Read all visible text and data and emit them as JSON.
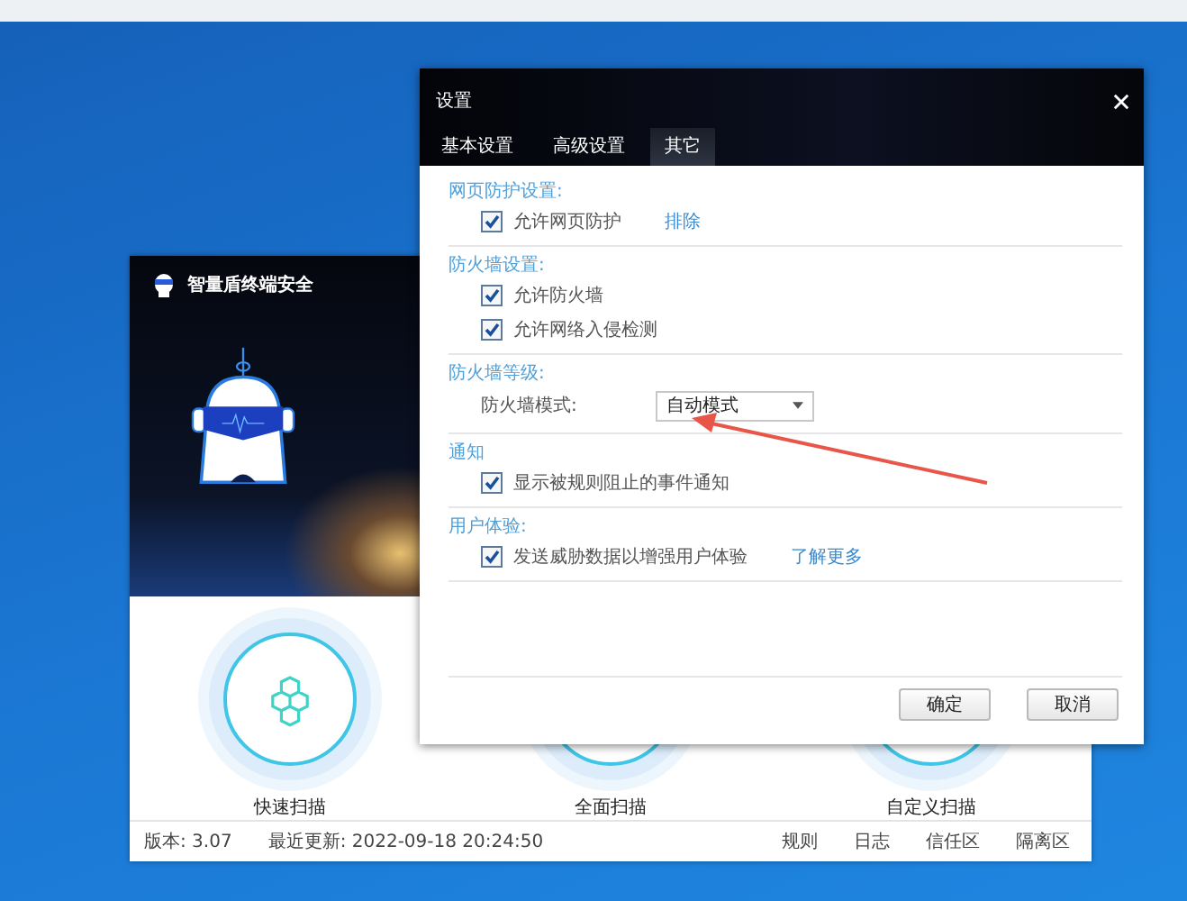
{
  "main_window": {
    "title": "智量盾终端安全",
    "scan_buttons": [
      {
        "label": "快速扫描"
      },
      {
        "label": "全面扫描"
      },
      {
        "label": "自定义扫描"
      }
    ],
    "status_bar": {
      "version": "版本: 3.07",
      "last_update": "最近更新: 2022-09-18 20:24:50",
      "links": [
        "规则",
        "日志",
        "信任区",
        "隔离区"
      ]
    }
  },
  "settings_dialog": {
    "title": "设置",
    "tabs": [
      {
        "label": "基本设置",
        "selected": false
      },
      {
        "label": "高级设置",
        "selected": false
      },
      {
        "label": "其它",
        "selected": true
      }
    ],
    "sections": [
      {
        "title": "网页防护设置:",
        "items": [
          {
            "kind": "checkbox",
            "label": "允许网页防护",
            "checked": true,
            "link": "排除"
          }
        ]
      },
      {
        "title": "防火墙设置:",
        "items": [
          {
            "kind": "checkbox",
            "label": "允许防火墙",
            "checked": true
          },
          {
            "kind": "checkbox",
            "label": "允许网络入侵检测",
            "checked": true
          }
        ]
      },
      {
        "title": "防火墙等级:",
        "items": [
          {
            "kind": "dropdown",
            "label": "防火墙模式:",
            "value": "自动模式"
          }
        ]
      },
      {
        "title": "通知",
        "items": [
          {
            "kind": "checkbox",
            "label": "显示被规则阻止的事件通知",
            "checked": true
          }
        ]
      },
      {
        "title": "用户体验:",
        "items": [
          {
            "kind": "checkbox",
            "label": "发送威胁数据以增强用户体验",
            "checked": true,
            "link": "了解更多"
          }
        ]
      }
    ],
    "buttons": [
      "确定",
      "取消"
    ]
  }
}
